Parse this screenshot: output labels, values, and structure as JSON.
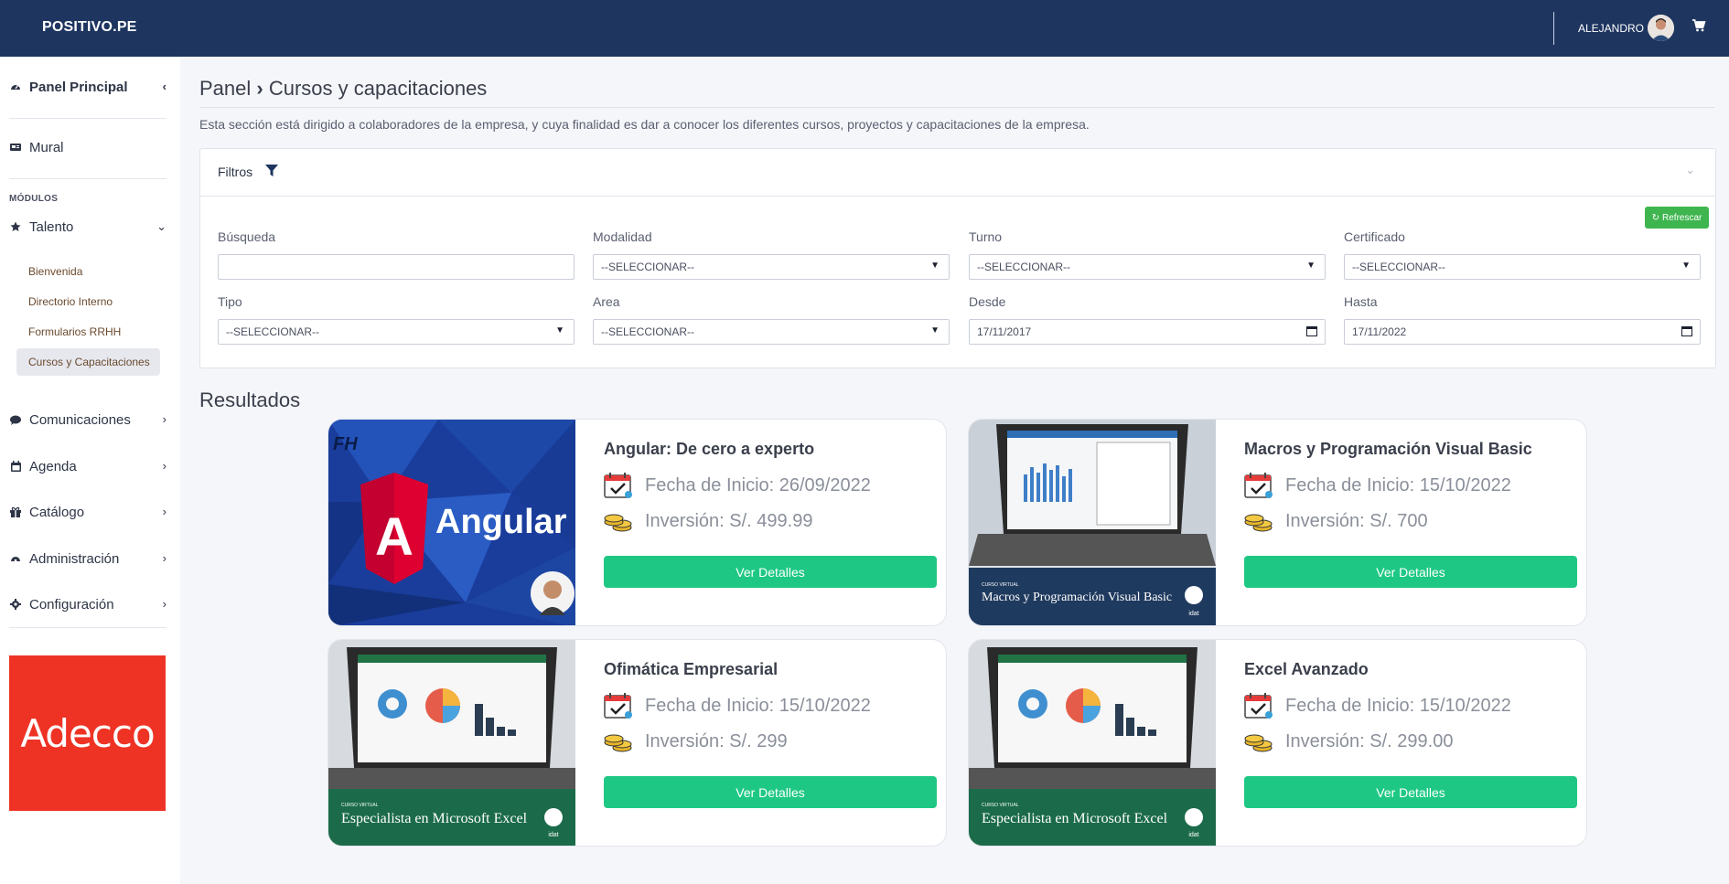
{
  "header": {
    "brand": "POSITIVO.PE",
    "user_name": "ALEJANDRO"
  },
  "sidebar": {
    "panel_principal": "Panel Principal",
    "mural": "Mural",
    "section_label": "MÓDULOS",
    "talento": "Talento",
    "sub_items": [
      "Bienvenida",
      "Directorio Interno",
      "Formularios RRHH",
      "Cursos y Capacitaciones"
    ],
    "items": [
      "Comunicaciones",
      "Agenda",
      "Catálogo",
      "Administración",
      "Configuración"
    ],
    "ad_brand": "Adecco"
  },
  "breadcrumb": {
    "root": "Panel",
    "separator": "›",
    "current": "Cursos y capacitaciones"
  },
  "description": "Esta sección está dirigido a colaboradores de la empresa, y cuya finalidad es dar a conocer los diferentes cursos, proyectos y capacitaciones de la empresa.",
  "filters": {
    "title": "Filtros",
    "refresh_label": "Refrescar",
    "busqueda": {
      "label": "Búsqueda",
      "value": ""
    },
    "modalidad": {
      "label": "Modalidad",
      "value": "--SELECCIONAR--"
    },
    "turno": {
      "label": "Turno",
      "value": "--SELECCIONAR--"
    },
    "certificado": {
      "label": "Certificado",
      "value": "--SELECCIONAR--"
    },
    "tipo": {
      "label": "Tipo",
      "value": "--SELECCIONAR--"
    },
    "area": {
      "label": "Area",
      "value": "--SELECCIONAR--"
    },
    "desde": {
      "label": "Desde",
      "value": "17/11/2017"
    },
    "hasta": {
      "label": "Hasta",
      "value": "17/11/2022"
    }
  },
  "results_title": "Resultados",
  "courses": [
    {
      "title": "Angular: De cero a experto",
      "fecha": "Fecha de Inicio: 26/09/2022",
      "inversion": "Inversión: S/. 499.99",
      "button": "Ver Detalles",
      "image_text": "Angular",
      "image_badge": "FH"
    },
    {
      "title": "Macros y Programación Visual Basic",
      "fecha": "Fecha de Inicio: 15/10/2022",
      "inversion": "Inversión: S/. 700",
      "button": "Ver Detalles",
      "image_kicker": "CURSO VIRTUAL",
      "image_text": "Macros y Programación Visual Basic",
      "image_logo": "idat"
    },
    {
      "title": "Ofimática Empresarial",
      "fecha": "Fecha de Inicio: 15/10/2022",
      "inversion": "Inversión: S/. 299",
      "button": "Ver Detalles",
      "image_kicker": "CURSO VIRTUAL",
      "image_text": "Especialista en Microsoft Excel",
      "image_logo": "idat"
    },
    {
      "title": "Excel Avanzado",
      "fecha": "Fecha de Inicio: 15/10/2022",
      "inversion": "Inversión: S/. 299.00",
      "button": "Ver Detalles",
      "image_kicker": "CURSO VIRTUAL",
      "image_text": "Especialista en Microsoft Excel",
      "image_logo": "idat"
    }
  ],
  "colors": {
    "topbar": "#1e3560",
    "button_green": "#1ec884",
    "refresh_green": "#3fb54f",
    "adecco_red": "#ee3325",
    "submenu_text": "#6b4a2e"
  },
  "icons": [
    "dashboard-icon",
    "newspaper-icon",
    "star-icon",
    "comments-icon",
    "calendar-icon",
    "gift-icon",
    "admin-icon",
    "gear-icon",
    "filter-icon",
    "refresh-icon",
    "cart-icon",
    "coins-icon"
  ]
}
